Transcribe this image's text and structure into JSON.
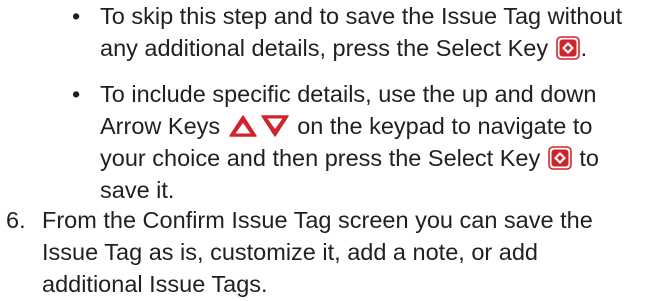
{
  "bullets": [
    {
      "mark": "•",
      "text_1": "To skip this step and to save the Issue Tag without any additional details, press the Select Key",
      "text_2": "."
    },
    {
      "mark": "•",
      "text_1": "To include specific details, use the up and down Arrow Keys",
      "text_2": "on the keypad to navigate to your choice and then press the Select Key",
      "text_3": "to save it."
    }
  ],
  "step": {
    "number": "6.",
    "text": "From the Confirm Issue Tag screen you can save the Issue Tag as is, customize it, add a note, or add additional Issue Tags."
  },
  "icons": {
    "select_key": "select-key-icon",
    "up_arrow": "up-arrow-key-icon",
    "down_arrow": "down-arrow-key-icon"
  },
  "colors": {
    "text": "#231f20",
    "key_red": "#d2232a",
    "key_white": "#ffffff"
  }
}
